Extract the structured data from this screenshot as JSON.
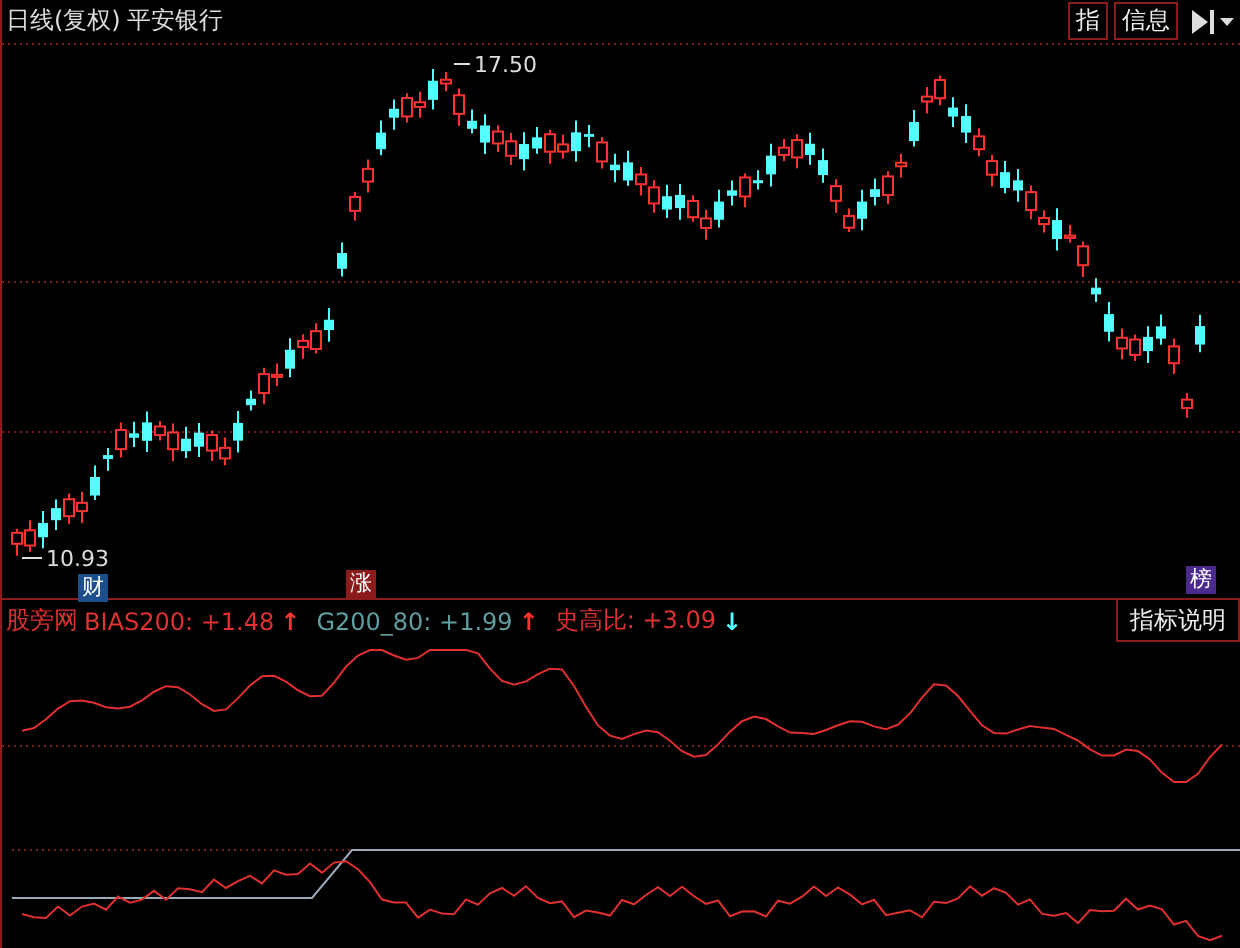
{
  "chart": {
    "period": "日线(复权)",
    "stock": "平安银行",
    "high_label": "17.50",
    "low_label": "10.93"
  },
  "toolbar": [
    {
      "label": "指"
    },
    {
      "label": "信息"
    }
  ],
  "markers": [
    {
      "label": "财",
      "color": "#1c4f8c"
    },
    {
      "label": "涨",
      "color": "#8c1c1c"
    },
    {
      "label": "榜",
      "color": "#4a2a8c"
    }
  ],
  "indicator": {
    "name": "股旁网",
    "readings": [
      {
        "label": "BIAS200:",
        "value": "+1.48",
        "arrow": "↑",
        "color": "#e03030"
      },
      {
        "label": "G200_80:",
        "value": "+1.99",
        "arrow": "↑",
        "color": "#5f9ea0"
      },
      {
        "label": "史高比:",
        "value": "+3.09",
        "arrow": "↓",
        "color": "#e03030"
      }
    ],
    "explain_button": "指标说明"
  }
}
